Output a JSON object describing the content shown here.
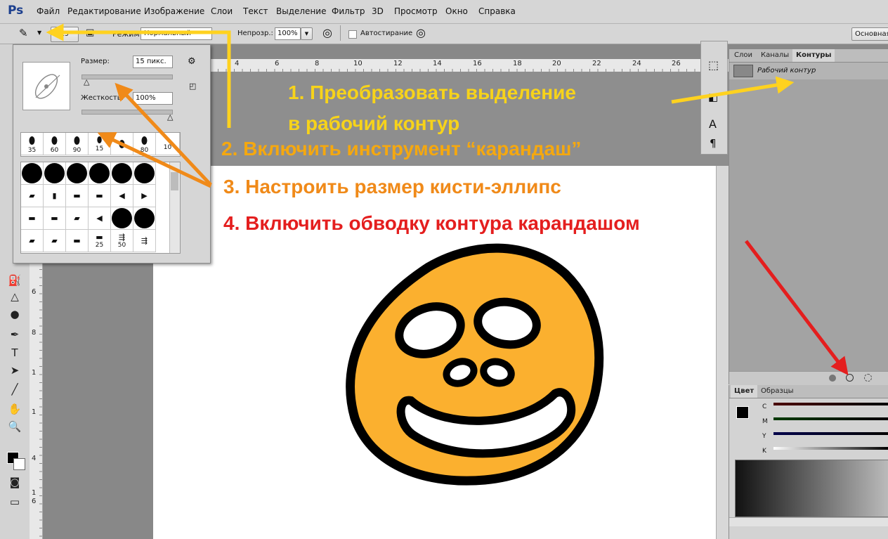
{
  "app": {
    "logo": "Ps"
  },
  "menu": [
    "Файл",
    "Редактирование",
    "Изображение",
    "Слои",
    "Текст",
    "Выделение",
    "Фильтр",
    "3D",
    "Просмотр",
    "Окно",
    "Справка"
  ],
  "options": {
    "brush_size": "15",
    "mode_label": "Режим:",
    "mode_value": "Нормальный",
    "opacity_label": "Непрозр.:",
    "opacity_value": "100%",
    "autoerase_label": "Автостирание",
    "workspace_button": "Основная"
  },
  "brush_panel": {
    "size_label": "Размер:",
    "size_value": "15 пикс.",
    "hardness_label": "Жесткость:",
    "hardness_value": "100%",
    "presets": [
      "35",
      "60",
      "90",
      "15",
      "80",
      "10"
    ],
    "grid_labels": [
      "25",
      "50"
    ]
  },
  "ruler": {
    "ticks": [
      "4",
      "6",
      "8",
      "10",
      "12",
      "14",
      "16",
      "18",
      "20",
      "22",
      "24",
      "26"
    ],
    "left_ticks": [
      "6",
      "8",
      "1",
      "1",
      "4",
      "1",
      "6"
    ]
  },
  "panels": {
    "paths_tabs": [
      "Слои",
      "Каналы",
      "Контуры"
    ],
    "work_path": "Рабочий контур",
    "color_tabs": [
      "Цвет",
      "Образцы"
    ],
    "cmyk": [
      "C",
      "M",
      "Y",
      "K"
    ]
  },
  "annotations": [
    {
      "text": "1. Преобразовать выделение",
      "color": "#f7d31a"
    },
    {
      "text": "в рабочий контур",
      "color": "#f7d31a"
    },
    {
      "text": "2. Включить инструмент “карандаш”",
      "color": "#f5a80f"
    },
    {
      "text": "3. Настроить размер кисти-эллипс",
      "color": "#f08a19"
    },
    {
      "text": "4. Включить обводку контура карандашом",
      "color": "#e41e1e"
    }
  ],
  "colors": {
    "smiley": "#fbb02f",
    "arrow_yellow": "#ffd21f",
    "arrow_orange": "#f08a19",
    "arrow_red": "#e41e1e"
  }
}
